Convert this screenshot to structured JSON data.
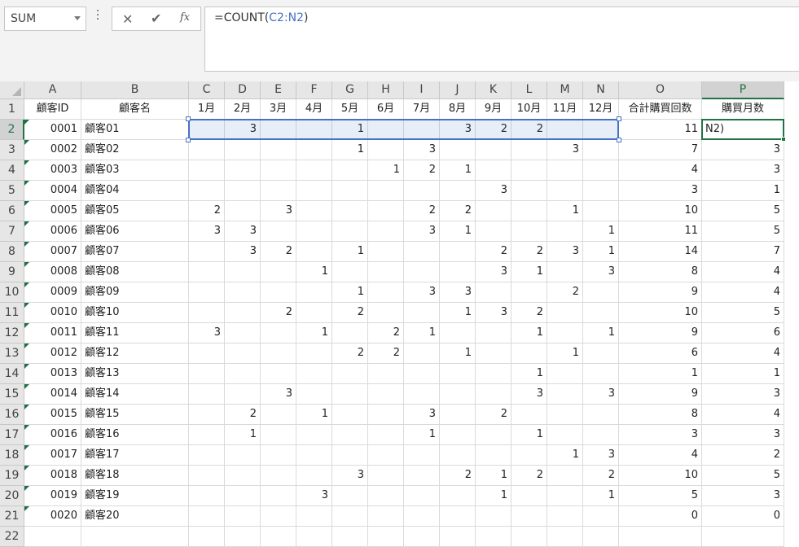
{
  "name_box": {
    "value": "SUM"
  },
  "formula_bar": {
    "prefix": "=COUNT(",
    "range": "C2:N2",
    "suffix": ")"
  },
  "columns": [
    "A",
    "B",
    "C",
    "D",
    "E",
    "F",
    "G",
    "H",
    "I",
    "J",
    "K",
    "L",
    "M",
    "N",
    "O",
    "P"
  ],
  "selected_column": "P",
  "selected_row": 2,
  "header_row": [
    "顧客ID",
    "顧客名",
    "1月",
    "2月",
    "3月",
    "4月",
    "5月",
    "6月",
    "7月",
    "8月",
    "9月",
    "10月",
    "11月",
    "12月",
    "合計購買回数",
    "購買月数"
  ],
  "rows": [
    [
      "0001",
      "顧客01",
      "",
      "3",
      "",
      "",
      "1",
      "",
      "",
      "3",
      "2",
      "2",
      "",
      "",
      "11",
      "N2)"
    ],
    [
      "0002",
      "顧客02",
      "",
      "",
      "",
      "",
      "1",
      "",
      "3",
      "",
      "",
      "",
      "3",
      "",
      "7",
      "3"
    ],
    [
      "0003",
      "顧客03",
      "",
      "",
      "",
      "",
      "",
      "1",
      "2",
      "1",
      "",
      "",
      "",
      "",
      "4",
      "3"
    ],
    [
      "0004",
      "顧客04",
      "",
      "",
      "",
      "",
      "",
      "",
      "",
      "",
      "3",
      "",
      "",
      "",
      "3",
      "1"
    ],
    [
      "0005",
      "顧客05",
      "2",
      "",
      "3",
      "",
      "",
      "",
      "2",
      "2",
      "",
      "",
      "1",
      "",
      "10",
      "5"
    ],
    [
      "0006",
      "顧客06",
      "3",
      "3",
      "",
      "",
      "",
      "",
      "3",
      "1",
      "",
      "",
      "",
      "1",
      "11",
      "5"
    ],
    [
      "0007",
      "顧客07",
      "",
      "3",
      "2",
      "",
      "1",
      "",
      "",
      "",
      "2",
      "2",
      "3",
      "1",
      "14",
      "7"
    ],
    [
      "0008",
      "顧客08",
      "",
      "",
      "",
      "1",
      "",
      "",
      "",
      "",
      "3",
      "1",
      "",
      "3",
      "8",
      "4"
    ],
    [
      "0009",
      "顧客09",
      "",
      "",
      "",
      "",
      "1",
      "",
      "3",
      "3",
      "",
      "",
      "2",
      "",
      "9",
      "4"
    ],
    [
      "0010",
      "顧客10",
      "",
      "",
      "2",
      "",
      "2",
      "",
      "",
      "1",
      "3",
      "2",
      "",
      "",
      "10",
      "5"
    ],
    [
      "0011",
      "顧客11",
      "3",
      "",
      "",
      "1",
      "",
      "2",
      "1",
      "",
      "",
      "1",
      "",
      "1",
      "9",
      "6"
    ],
    [
      "0012",
      "顧客12",
      "",
      "",
      "",
      "",
      "2",
      "2",
      "",
      "1",
      "",
      "",
      "1",
      "",
      "6",
      "4"
    ],
    [
      "0013",
      "顧客13",
      "",
      "",
      "",
      "",
      "",
      "",
      "",
      "",
      "",
      "1",
      "",
      "",
      "1",
      "1"
    ],
    [
      "0014",
      "顧客14",
      "",
      "",
      "3",
      "",
      "",
      "",
      "",
      "",
      "",
      "3",
      "",
      "3",
      "9",
      "3"
    ],
    [
      "0015",
      "顧客15",
      "",
      "2",
      "",
      "1",
      "",
      "",
      "3",
      "",
      "2",
      "",
      "",
      "",
      "8",
      "4"
    ],
    [
      "0016",
      "顧客16",
      "",
      "1",
      "",
      "",
      "",
      "",
      "1",
      "",
      "",
      "1",
      "",
      "",
      "3",
      "3"
    ],
    [
      "0017",
      "顧客17",
      "",
      "",
      "",
      "",
      "",
      "",
      "",
      "",
      "",
      "",
      "1",
      "3",
      "4",
      "2"
    ],
    [
      "0018",
      "顧客18",
      "",
      "",
      "",
      "",
      "3",
      "",
      "",
      "2",
      "1",
      "2",
      "",
      "2",
      "10",
      "5"
    ],
    [
      "0019",
      "顧客19",
      "",
      "",
      "",
      "3",
      "",
      "",
      "",
      "",
      "1",
      "",
      "",
      "1",
      "5",
      "3"
    ],
    [
      "0020",
      "顧客20",
      "",
      "",
      "",
      "",
      "",
      "",
      "",
      "",
      "",
      "",
      "",
      "",
      "0",
      "0"
    ],
    [
      "",
      "",
      "",
      "",
      "",
      "",
      "",
      "",
      "",
      "",
      "",
      "",
      "",
      "",
      "",
      ""
    ]
  ],
  "icons": {
    "cancel": "close-icon",
    "enter": "check-icon",
    "function": "fx-icon"
  },
  "colors": {
    "range_border": "#4472c4",
    "active_border": "#217346"
  }
}
